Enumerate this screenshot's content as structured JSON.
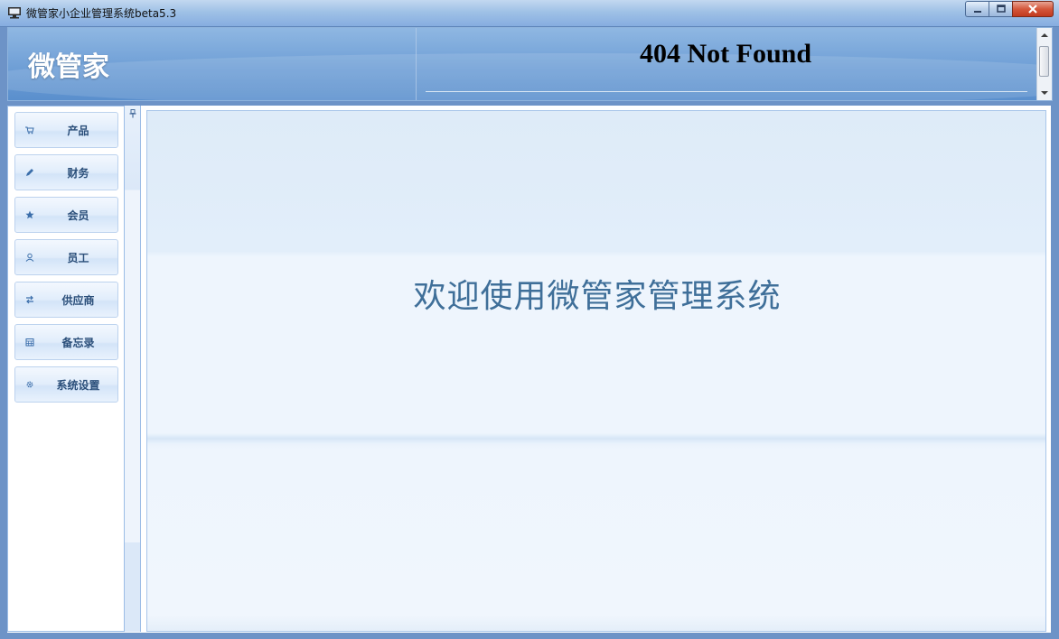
{
  "window": {
    "title": "微管家小企业管理系统beta5.3"
  },
  "header": {
    "brand": "微管家",
    "notice": "404 Not Found"
  },
  "sidebar": {
    "items": [
      {
        "label": "产品",
        "icon": "cart-icon"
      },
      {
        "label": "财务",
        "icon": "pencil-icon"
      },
      {
        "label": "会员",
        "icon": "star-icon"
      },
      {
        "label": "员工",
        "icon": "user-icon"
      },
      {
        "label": "供应商",
        "icon": "exchange-icon"
      },
      {
        "label": "备忘录",
        "icon": "calendar-icon"
      },
      {
        "label": "系统设置",
        "icon": "gear-icon"
      }
    ]
  },
  "main": {
    "welcome": "欢迎使用微管家管理系统"
  },
  "colors": {
    "accent": "#3f6f99",
    "header_bg": "#6f9fd6",
    "nav_text": "#2b4f7a"
  }
}
